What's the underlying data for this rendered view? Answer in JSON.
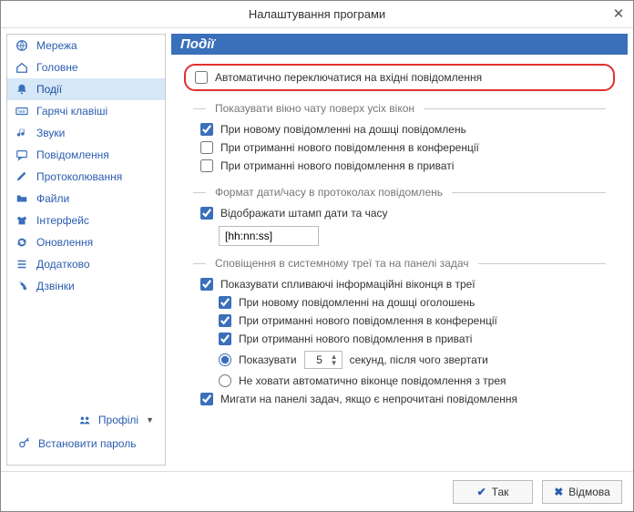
{
  "window": {
    "title": "Налаштування програми"
  },
  "sidebar": {
    "items": [
      {
        "label": "Мережа",
        "icon": "globe-icon"
      },
      {
        "label": "Головне",
        "icon": "home-icon"
      },
      {
        "label": "Події",
        "icon": "bell-icon"
      },
      {
        "label": "Гарячі клавіші",
        "icon": "keyboard-icon"
      },
      {
        "label": "Звуки",
        "icon": "note-icon"
      },
      {
        "label": "Повідомлення",
        "icon": "message-icon"
      },
      {
        "label": "Протоколювання",
        "icon": "pencil-icon"
      },
      {
        "label": "Файли",
        "icon": "folder-icon"
      },
      {
        "label": "Інтерфейс",
        "icon": "shirt-icon"
      },
      {
        "label": "Оновлення",
        "icon": "refresh-icon"
      },
      {
        "label": "Додатково",
        "icon": "list-icon"
      },
      {
        "label": "Дзвінки",
        "icon": "phone-icon"
      }
    ],
    "profiles": "Профілі",
    "set_password": "Встановити пароль"
  },
  "content": {
    "heading": "Події",
    "auto_switch": "Автоматично переключатися на вхідні повідомлення",
    "group1": {
      "title": "Показувати вікно чату поверх усіх вікон",
      "opt1": "При новому повідомленні на дошці повідомлень",
      "opt2": "При отриманні нового повідомлення в конференції",
      "opt3": "При отриманні нового повідомлення в приваті"
    },
    "group2": {
      "title": "Формат дати/часу в протоколах повідомлень",
      "opt1": "Відображати штамп дати та часу",
      "format": "[hh:nn:ss]"
    },
    "group3": {
      "title": "Сповіщення в системному треї та на панелі задач",
      "opt1": "Показувати спливаючі інформаційні віконця в треї",
      "sub1": "При новому повідомленні на дошці оголошень",
      "sub2": "При отриманні нового повідомлення в конференції",
      "sub3": "При отриманні нового повідомлення в приваті",
      "show_label": "Показувати",
      "seconds_value": "5",
      "seconds_suffix": "секунд, після чого звертати",
      "dont_hide": "Не ховати автоматично віконце повідомлення з трея",
      "blink": "Мигати на панелі задач, якщо є непрочитані повідомлення"
    }
  },
  "buttons": {
    "ok": "Так",
    "cancel": "Відмова"
  }
}
